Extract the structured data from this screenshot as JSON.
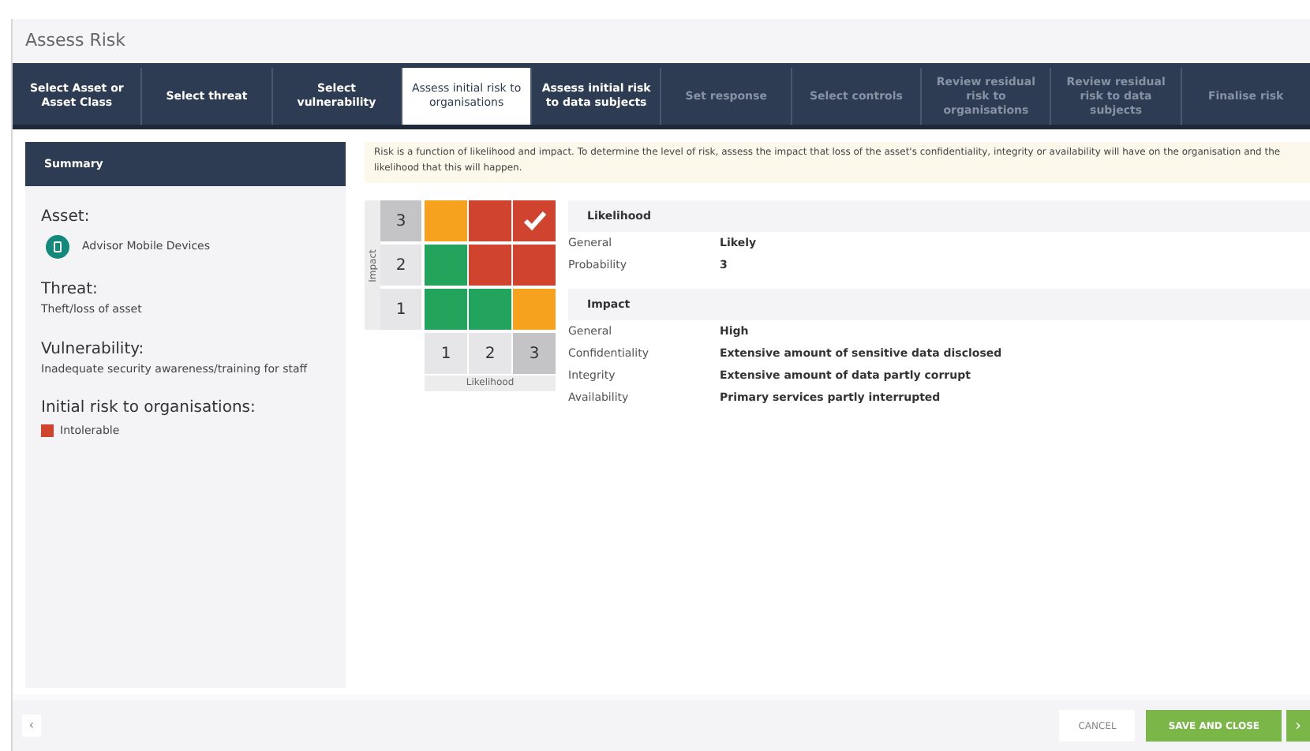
{
  "window": {
    "title": "Assess Risk"
  },
  "tabs": [
    {
      "label": "Select Asset or Asset Class",
      "selected": false,
      "disabled": false
    },
    {
      "label": "Select threat",
      "selected": false,
      "disabled": false
    },
    {
      "label": "Select vulnerability",
      "selected": false,
      "disabled": false
    },
    {
      "label": "Assess initial risk to organisations",
      "selected": true,
      "disabled": false
    },
    {
      "label": "Assess initial risk to data subjects",
      "selected": false,
      "disabled": false
    },
    {
      "label": "Set response",
      "selected": false,
      "disabled": true
    },
    {
      "label": "Select controls",
      "selected": false,
      "disabled": true
    },
    {
      "label": "Review residual risk to organisations",
      "selected": false,
      "disabled": true
    },
    {
      "label": "Review residual risk to data subjects",
      "selected": false,
      "disabled": true
    },
    {
      "label": "Finalise risk",
      "selected": false,
      "disabled": true
    }
  ],
  "summary": {
    "title": "Summary",
    "asset_label": "Asset:",
    "asset": "Advisor Mobile Devices",
    "threat_label": "Threat:",
    "threat": "Theft/loss of asset",
    "vulnerability_label": "Vulnerability:",
    "vulnerability": "Inadequate security awareness/training for staff",
    "risk_label": "Initial risk to organisations:",
    "risk": {
      "text": "Intolerable",
      "color": "#d0432e"
    }
  },
  "notice": "Risk is a function of likelihood and impact. To determine the level of risk, assess the impact that loss of the asset's confidentiality, integrity or availability will have on the organisation and the likelihood that this will happen.",
  "matrix": {
    "y_axis": "Impact",
    "x_axis": "Likelihood",
    "rows": [
      {
        "label": "3",
        "selected": true,
        "cells": [
          {
            "color": "#f6a21e",
            "selected": false
          },
          {
            "color": "#d0432e",
            "selected": false
          },
          {
            "color": "#d0432e",
            "selected": true
          }
        ]
      },
      {
        "label": "2",
        "selected": false,
        "cells": [
          {
            "color": "#22a45d",
            "selected": false
          },
          {
            "color": "#d0432e",
            "selected": false
          },
          {
            "color": "#d0432e",
            "selected": false
          }
        ]
      },
      {
        "label": "1",
        "selected": false,
        "cells": [
          {
            "color": "#22a45d",
            "selected": false
          },
          {
            "color": "#22a45d",
            "selected": false
          },
          {
            "color": "#f6a21e",
            "selected": false
          }
        ]
      }
    ],
    "columns": [
      {
        "label": "1",
        "selected": false
      },
      {
        "label": "2",
        "selected": false
      },
      {
        "label": "3",
        "selected": true
      }
    ]
  },
  "details": [
    {
      "title": "Likelihood",
      "rows": [
        {
          "label": "General",
          "value": "Likely"
        },
        {
          "label": "Probability",
          "value": "3"
        }
      ]
    },
    {
      "title": "Impact",
      "rows": [
        {
          "label": "General",
          "value": "High"
        },
        {
          "label": "Confidentiality",
          "value": "Extensive amount of sensitive data disclosed"
        },
        {
          "label": "Integrity",
          "value": "Extensive amount of data partly corrupt"
        },
        {
          "label": "Availability",
          "value": "Primary services partly interrupted"
        }
      ]
    }
  ],
  "footer": {
    "back": "‹",
    "cancel": "CANCEL",
    "save": "SAVE AND CLOSE",
    "next": "›"
  }
}
